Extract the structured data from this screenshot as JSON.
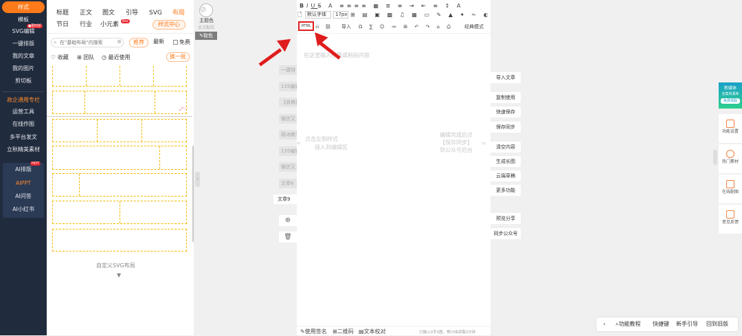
{
  "leftnav": {
    "active": "样式",
    "items": [
      "模板",
      "SVG编辑",
      "一键排版",
      "我的文章",
      "我的图片",
      "剪切板"
    ],
    "svg_badge": "●限时折",
    "section": "政企通用专栏",
    "items2": [
      "运营工具",
      "在线作图",
      "多平台发文",
      "立秋精美素材"
    ],
    "ai_badge": "HOT",
    "ai_items": [
      "AI排版",
      "AIPPT",
      "AI问答",
      "AI小红书"
    ]
  },
  "panel": {
    "tabs_row1": [
      "标题",
      "正文",
      "图文",
      "引导",
      "SVG",
      "布局"
    ],
    "tabs_row2": [
      "节日",
      "行业",
      "小元素"
    ],
    "new_badge": "New",
    "style_center": "样式中心",
    "search_placeholder": "在\"基础布局\"内搜索",
    "recommend": "推荐",
    "latest": "最新",
    "free": "免费",
    "favorite": "收藏",
    "team": "团队",
    "recent": "最近使用",
    "refresh": "换一批",
    "custom_svg": "自定义SVG布局"
  },
  "colorpanel": {
    "theme_color": "主题色",
    "full_text": "全文配白",
    "pick_color": "取色"
  },
  "strip": {
    "items": [
      "一键排",
      "135编辑",
      "【收稿】",
      "微信又",
      "敲冰教学",
      "135编辑",
      "微信又",
      "文章8"
    ],
    "active": "文章9"
  },
  "editor": {
    "font": "默认字体",
    "size": "17px",
    "html_label": "HTML",
    "import": "导入",
    "mode": "经典模式",
    "title_hint": "在这里输入标题或粘贴内容",
    "left_hint_1": "点击左侧样式",
    "left_hint_2": "插入到编辑区",
    "right_hint_1": "编辑完成后点",
    "right_hint_2": "【保存同步】",
    "right_hint_3": "到公众号后台",
    "footer_sign": "使用签名",
    "footer_qr": "二维码",
    "footer_check": "文本校对",
    "footer_count": "已输入0字0图，预计阅读需0分钟"
  },
  "actions": [
    "导入文章",
    "复制使用",
    "快速保存",
    "保存同步",
    "清空内容",
    "生成长图",
    "云端草稿",
    "更多功能",
    "预览分享",
    "同步公众号"
  ],
  "rside": {
    "promo_title": "新媒体",
    "promo_sub": "全案资源库",
    "promo_btn": "免费领取",
    "items": [
      "功能设置",
      "热门素材",
      "在线配图",
      "意见反馈"
    ]
  },
  "bottombar": {
    "tutorial": "功能教程",
    "shortcut": "快捷键",
    "guide": "新手引导",
    "old": "回到旧版"
  }
}
